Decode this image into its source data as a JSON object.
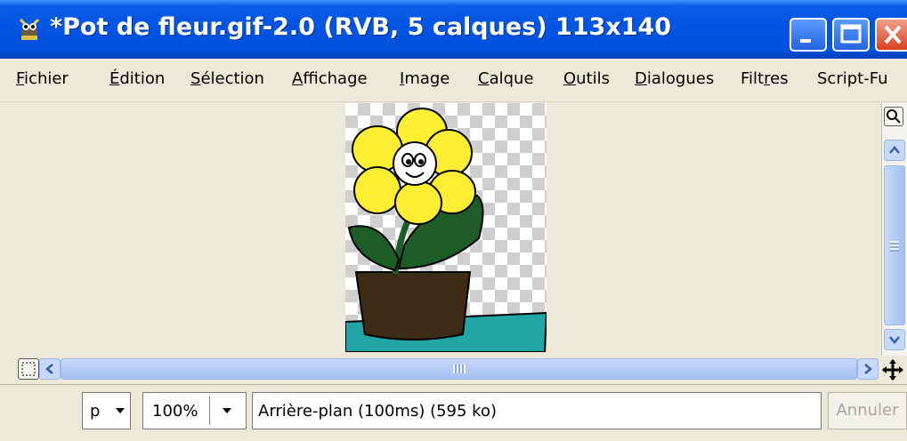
{
  "window": {
    "title": "*Pot de fleur.gif-2.0 (RVB, 5 calques) 113x140",
    "icon": "gimp-wilber-icon",
    "controls": [
      "minimize-icon",
      "maximize-icon",
      "close-icon"
    ],
    "accent_color": "#0054e3",
    "close_color": "#d7401f"
  },
  "menubar": {
    "items": [
      {
        "mnemonic": "F",
        "rest": "ichier"
      },
      {
        "mnemonic": "É",
        "rest": "dition"
      },
      {
        "mnemonic": "S",
        "rest": "élection"
      },
      {
        "mnemonic": "A",
        "rest": "ffichage"
      },
      {
        "mnemonic": "I",
        "rest": "mage"
      },
      {
        "mnemonic": "C",
        "rest": "alque"
      },
      {
        "mnemonic": "O",
        "rest": "utils"
      },
      {
        "mnemonic": "D",
        "rest": "ialogues"
      },
      {
        "pre": "Filt",
        "mnemonic": "r",
        "rest": "es"
      },
      {
        "plain": "Script-Fu"
      }
    ]
  },
  "canvas": {
    "image_description_icon": "flower-pot-image",
    "colors": {
      "petals": "#ffee33",
      "leaves": "#1e5c28",
      "pot": "#3c2c15",
      "ground": "#22a6a5",
      "checker": "#cfcfcf"
    }
  },
  "scrollbars": {
    "zoom_button_icon": "magnifier-icon",
    "navigate_button_icon": "navigate-icon",
    "move_icon": "move-icon"
  },
  "statusbar": {
    "unit_value": "p",
    "zoom_value": "100%",
    "status_text": "Arrière-plan (100ms) (595 ko)",
    "cancel_label": "Annuler"
  }
}
